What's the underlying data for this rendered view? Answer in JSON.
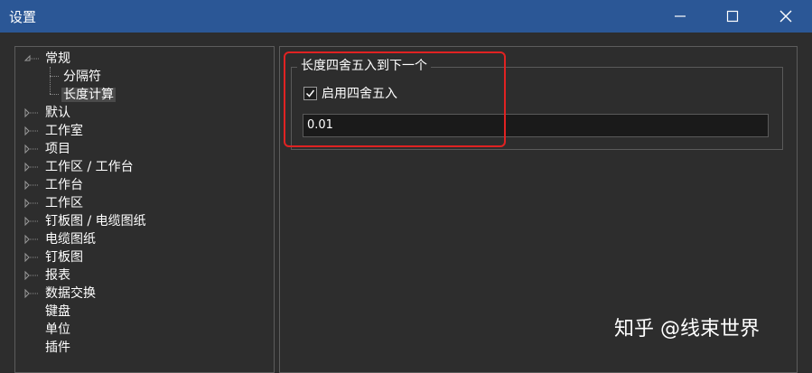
{
  "window": {
    "title": "设置",
    "controls": {
      "minimize_icon": "minimize-icon",
      "maximize_icon": "maximize-icon",
      "close_icon": "close-icon"
    }
  },
  "tree": {
    "items": [
      {
        "label": "常规",
        "expander": "expanded"
      },
      {
        "label": "分隔符",
        "expander": "none"
      },
      {
        "label": "长度计算",
        "expander": "none",
        "selected": true
      },
      {
        "label": "默认",
        "expander": "collapsed"
      },
      {
        "label": "工作室",
        "expander": "collapsed"
      },
      {
        "label": "项目",
        "expander": "collapsed"
      },
      {
        "label": "工作区 / 工作台",
        "expander": "collapsed"
      },
      {
        "label": "工作台",
        "expander": "collapsed"
      },
      {
        "label": "工作区",
        "expander": "collapsed"
      },
      {
        "label": "钉板图 / 电缆图纸",
        "expander": "collapsed"
      },
      {
        "label": "电缆图纸",
        "expander": "collapsed"
      },
      {
        "label": "钉板图",
        "expander": "collapsed"
      },
      {
        "label": "报表",
        "expander": "collapsed"
      },
      {
        "label": "数据交换",
        "expander": "collapsed"
      },
      {
        "label": "键盘",
        "expander": "none"
      },
      {
        "label": "单位",
        "expander": "none"
      },
      {
        "label": "插件",
        "expander": "none"
      }
    ]
  },
  "settings": {
    "group_title": "长度四舍五入到下一个",
    "checkbox_label": "启用四舍五入",
    "checkbox_checked": true,
    "value": "0.01"
  },
  "watermark": "知乎 @线束世界",
  "colors": {
    "titlebar": "#2b5796",
    "background": "#2d2d2d",
    "highlight": "#e02222"
  }
}
